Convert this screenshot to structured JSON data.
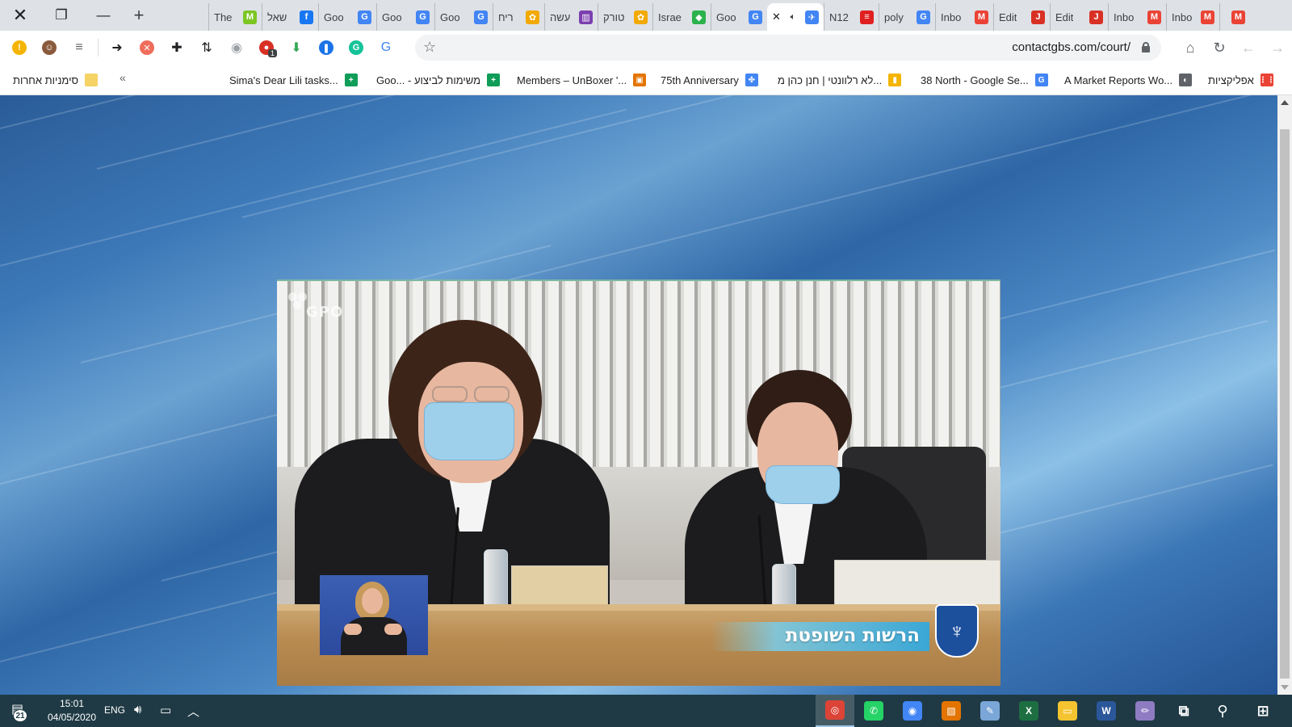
{
  "window": {
    "close_glyph": "✕",
    "restore_glyph": "❐",
    "minimize_glyph": "—",
    "new_tab_glyph": "+"
  },
  "tabs": [
    {
      "title": "",
      "favicon": "gmail-icon",
      "color": "#ea4335",
      "glyph": "M"
    },
    {
      "title": "Inbo",
      "favicon": "gmail-icon",
      "color": "#ea4335",
      "glyph": "M"
    },
    {
      "title": "Inbo",
      "favicon": "gmail-icon",
      "color": "#ea4335",
      "glyph": "M"
    },
    {
      "title": "Edit",
      "favicon": "j-icon",
      "color": "#d93025",
      "glyph": "J"
    },
    {
      "title": "Edit",
      "favicon": "j-icon",
      "color": "#d93025",
      "glyph": "J"
    },
    {
      "title": "Inbo",
      "favicon": "gmail-icon",
      "color": "#ea4335",
      "glyph": "M"
    },
    {
      "title": "poly",
      "favicon": "google-icon",
      "color": "#4285f4",
      "glyph": "G"
    },
    {
      "title": "N12",
      "favicon": "n12-icon",
      "color": "#e02020",
      "glyph": "≡"
    },
    {
      "title": "",
      "favicon": "audio-tab-icon",
      "color": "#4285f4",
      "glyph": "✈",
      "active": true
    },
    {
      "title": "Goo",
      "favicon": "translate-icon",
      "color": "#4285f4",
      "glyph": "G"
    },
    {
      "title": "Israe",
      "favicon": "feedly-icon",
      "color": "#2bb24c",
      "glyph": "◆"
    },
    {
      "title": "טורק",
      "favicon": "colorful-icon",
      "color": "#f2a900",
      "glyph": "✿"
    },
    {
      "title": "עשה",
      "favicon": "colorful-icon",
      "color": "#7b3fb0",
      "glyph": "▥"
    },
    {
      "title": "ריח",
      "favicon": "colorful-icon",
      "color": "#f2a900",
      "glyph": "✿"
    },
    {
      "title": "Goo",
      "favicon": "translate-icon",
      "color": "#4285f4",
      "glyph": "G"
    },
    {
      "title": "Goo",
      "favicon": "translate-icon",
      "color": "#4285f4",
      "glyph": "G"
    },
    {
      "title": "Goo",
      "favicon": "translate-icon",
      "color": "#4285f4",
      "glyph": "G"
    },
    {
      "title": "שאל",
      "favicon": "facebook-icon",
      "color": "#1877f2",
      "glyph": "f"
    },
    {
      "title": "The",
      "favicon": "m-green-icon",
      "color": "#7cc623",
      "glyph": "M"
    }
  ],
  "toolbar": {
    "url": "contactgbs.com/court/",
    "extensions": [
      {
        "name": "warning-icon",
        "color": "#f4b400",
        "glyph": "!"
      },
      {
        "name": "profile-avatar",
        "color": "#8a5a3c",
        "glyph": "☺"
      },
      {
        "name": "reading-list-icon",
        "color": "#5f6368",
        "glyph": "≡"
      },
      {
        "name": "share-arrow-icon",
        "color": "#202124",
        "glyph": "➜"
      },
      {
        "name": "block-extension-icon",
        "color": "#f06d5b",
        "glyph": "✕"
      },
      {
        "name": "puzzle-extensions-icon",
        "color": "#202124",
        "glyph": "✚"
      },
      {
        "name": "sort-extension-icon",
        "color": "#202124",
        "glyph": "⇅"
      },
      {
        "name": "camera-extension-icon",
        "color": "#9aa0a6",
        "glyph": "◉"
      },
      {
        "name": "adblock-extension-icon",
        "color": "#d93025",
        "glyph": "●",
        "badge": "1"
      },
      {
        "name": "save-extension-icon",
        "color": "#34a853",
        "glyph": "⬇"
      },
      {
        "name": "bookmark-extension-icon",
        "color": "#1a73e8",
        "glyph": "❚"
      },
      {
        "name": "grammarly-icon",
        "color": "#15c39a",
        "glyph": "G"
      },
      {
        "name": "translate-extension-icon",
        "color": "#4285f4",
        "glyph": "G"
      }
    ]
  },
  "bookmarks": {
    "other_bookmarks": "סימניות אחרות",
    "chevron": "«",
    "items": [
      {
        "label": "Sima's Dear Lili tasks...",
        "favicon": "sheets-icon",
        "color": "#0f9d58",
        "glyph": "+"
      },
      {
        "label": "Goo... - משימות לביצוע",
        "favicon": "sheets-icon",
        "color": "#0f9d58",
        "glyph": "+"
      },
      {
        "label": "Members – UnBoxer '...",
        "favicon": "unboxer-icon",
        "color": "#e37400",
        "glyph": "▣"
      },
      {
        "label": "75th Anniversary",
        "favicon": "dots-icon",
        "color": "#4285f4",
        "glyph": "✤"
      },
      {
        "label": "לא רלוונטי | חנן כהן מ...",
        "favicon": "bars-icon",
        "color": "#f4b400",
        "glyph": "▮"
      },
      {
        "label": "38 North - Google Se...",
        "favicon": "google-icon",
        "color": "#4285f4",
        "glyph": "G"
      },
      {
        "label": "A Market Reports Wo...",
        "favicon": "globe-icon",
        "color": "#5f6368",
        "glyph": "◐"
      },
      {
        "label": "אפליקציות",
        "favicon": "apps-grid-icon",
        "color": "#ea4335",
        "glyph": "⋮⋮"
      }
    ]
  },
  "video": {
    "watermark": "GPO",
    "banner": "הרשות השופטת",
    "emblem_glyph": "♆"
  },
  "taskbar": {
    "notification_count": "21",
    "time": "15:01",
    "date": "04/05/2020",
    "language": "ENG",
    "apps": [
      {
        "name": "chrome-profile-app",
        "color": "#db4437",
        "glyph": "◎",
        "active": true
      },
      {
        "name": "whatsapp-app",
        "color": "#25d366",
        "glyph": "✆"
      },
      {
        "name": "chrome-app",
        "color": "#4285f4",
        "glyph": "◉"
      },
      {
        "name": "photos-app",
        "color": "#e37400",
        "glyph": "▨"
      },
      {
        "name": "paint-app",
        "color": "#7aa6d8",
        "glyph": "✎"
      },
      {
        "name": "excel-app",
        "color": "#1d6f42",
        "glyph": "X"
      },
      {
        "name": "file-explorer-app",
        "color": "#f4c430",
        "glyph": "▭"
      },
      {
        "name": "word-app",
        "color": "#2b579a",
        "glyph": "W"
      },
      {
        "name": "paint3d-app",
        "color": "#8e7cc3",
        "glyph": "✏"
      },
      {
        "name": "task-view-app",
        "color": "#1f3a45",
        "glyph": "⧉"
      },
      {
        "name": "search-app",
        "color": "#1f3a45",
        "glyph": "⚲"
      },
      {
        "name": "start-app",
        "color": "#1f3a45",
        "glyph": "⊞"
      }
    ]
  }
}
